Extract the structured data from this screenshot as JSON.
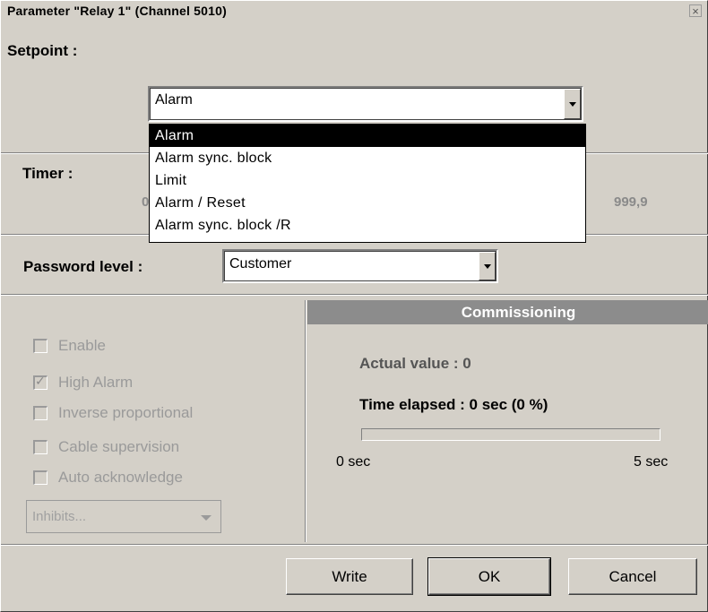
{
  "window": {
    "title": "Parameter \"Relay 1\" (Channel 5010)",
    "close_glyph": "×"
  },
  "setpoint": {
    "label": "Setpoint :",
    "selected": "Alarm",
    "options": [
      "Alarm",
      "Alarm sync. block",
      "Limit",
      "Alarm / Reset",
      "Alarm sync. block /R"
    ],
    "highlighted_index": 0
  },
  "timer": {
    "label": "Timer :",
    "min_value_partial": "0",
    "max_value": "999,9"
  },
  "password": {
    "label": "Password level :",
    "selected": "Customer"
  },
  "options_panel": {
    "enable": {
      "label": "Enable",
      "checked": false
    },
    "high_alarm": {
      "label": "High Alarm",
      "checked": true
    },
    "inverse_proportional": {
      "label": "Inverse proportional",
      "checked": false
    },
    "cable_supervision": {
      "label": "Cable supervision",
      "checked": false
    },
    "auto_acknowledge": {
      "label": "Auto acknowledge",
      "checked": false
    },
    "inhibits": {
      "placeholder": "Inhibits..."
    }
  },
  "commissioning": {
    "header": "Commissioning",
    "actual_value": "Actual value : 0",
    "time_elapsed": "Time elapsed : 0 sec (0 %)",
    "progress_fraction": 0,
    "scale_start": "0 sec",
    "scale_end": "5 sec"
  },
  "buttons": {
    "write": "Write",
    "ok": "OK",
    "cancel": "Cancel"
  },
  "colors": {
    "dialog_bg": "#d4d0c8",
    "header_bg": "#8c8c8c",
    "selection_bg": "#000000",
    "disabled_text": "#9a9a9a"
  }
}
